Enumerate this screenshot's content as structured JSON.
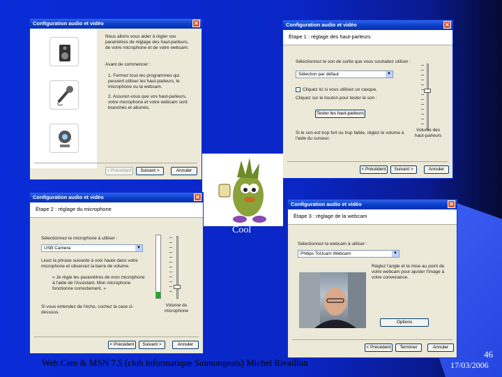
{
  "slide": {
    "footer": "Web.Cam & MSN 7.5 (club informatique Saintongeais)  Michel Rivaillon",
    "page_number": "46",
    "date": "17/03/2006",
    "caption": "Cool"
  },
  "dialogs": {
    "intro": {
      "title": "Configuration audio et vidéo",
      "intro_text": "Nous allons vous aider à régler vos paramètres de réglage des haut-parleurs, de votre microphone et de votre webcam.",
      "section_label": "Avant de commencer :",
      "bullet1": "1. Fermez tous les programmes qui peuvent utiliser les haut-parleurs, le microphone ou la webcam.",
      "bullet2": "2. Assurez-vous que vos haut-parleurs, votre microphone et votre webcam sont branchés et allumés.",
      "btn_prev": "< Précédent",
      "btn_next": "Suivant >",
      "btn_cancel": "Annuler"
    },
    "speakers": {
      "title": "Configuration audio et vidéo",
      "step": "Étape 1 : réglage des haut-parleurs",
      "label": "Sélectionnez le son de sortie que vous souhaitez utiliser :",
      "combo": "Sélection par défaut",
      "check": "Cliquez ici si vous utilisez un casque.",
      "test_text": "Cliquez sur le bouton pour tester le son :",
      "test_btn": "Tester les haut-parleurs",
      "slider_label": "Volume des haut-parleurs",
      "hint": "Si le son est trop fort ou trop faible, réglez le volume à l'aide du curseur.",
      "btn_prev": "< Précédent",
      "btn_next": "Suivant >",
      "btn_cancel": "Annuler"
    },
    "microphone": {
      "title": "Configuration audio et vidéo",
      "step": "Étape 2 : réglage du microphone",
      "label": "Sélectionnez le microphone à utiliser :",
      "combo": "USB Camera",
      "desc": "Lisez la phrase suivante à voix haute dans votre microphone et observez la barre de volume.",
      "quote": "« Je règle les paramètres de mon microphone à l'aide de l'Assistant. Mon microphone fonctionne correctement. »",
      "hint": "Si vous entendez de l'écho, cochez la case ci-dessous.",
      "slider_label": "Volume du microphone",
      "btn_prev": "< Précédent",
      "btn_next": "Suivant >",
      "btn_cancel": "Annuler"
    },
    "webcam": {
      "title": "Configuration audio et vidéo",
      "step": "Étape 3 : réglage de la webcam",
      "label": "Sélectionnez la webcam à utiliser :",
      "combo": "Philips ToUcam Webcam",
      "hint": "Réglez l'angle et la mise au point de votre webcam pour ajuster l'image à votre convenance.",
      "options_btn": "Options",
      "btn_prev": "< Précédent",
      "btn_next": "Terminer",
      "btn_cancel": "Annuler"
    }
  }
}
